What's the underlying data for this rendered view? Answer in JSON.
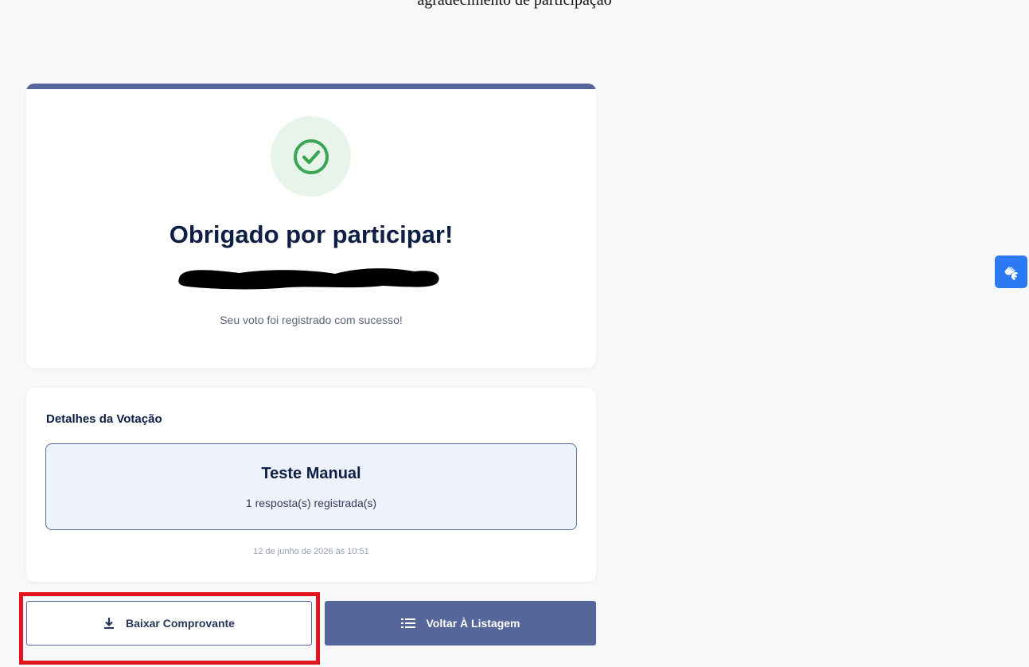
{
  "header": {
    "cropped_title": "agradecimento de participação"
  },
  "confirmation": {
    "title": "Obrigado por participar!",
    "message": "Seu voto foi registrado com sucesso!"
  },
  "details": {
    "section_title": "Detalhes da Votação",
    "vote_name": "Teste Manual",
    "response_count": "1 resposta(s) registrada(s)",
    "timestamp": "12 de junho de 2026 às 10:51"
  },
  "actions": {
    "download_label": "Baixar Comprovante",
    "back_label": "Voltar À Listagem"
  },
  "icons": {
    "success": "check-circle-icon",
    "download": "download-icon",
    "list": "list-icon",
    "accessibility": "sign-language-icon"
  },
  "colors": {
    "accent": "#56669a",
    "success": "#3aa655",
    "highlight": "#e3151c",
    "a11y": "#2b7af4"
  }
}
